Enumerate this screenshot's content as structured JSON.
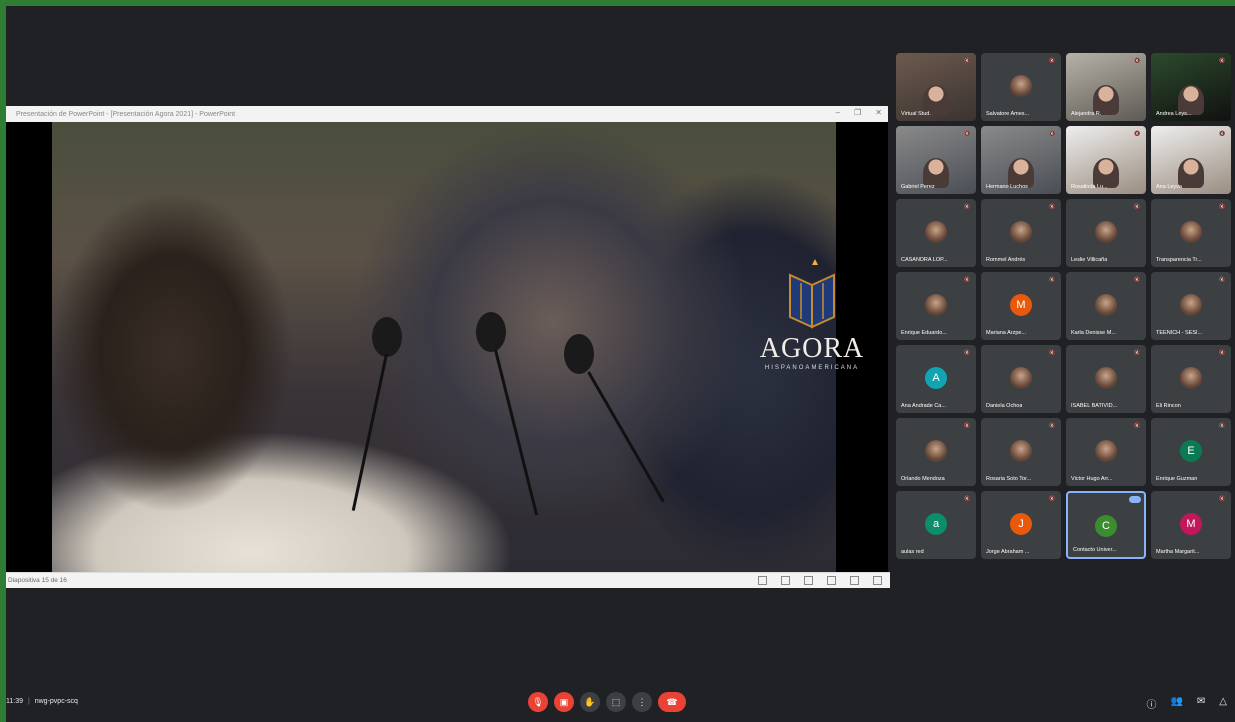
{
  "presentation": {
    "title": "Presentación de PowerPoint - [Presentación Agora 2021] - PowerPoint",
    "status": "Diapositiva 15 de 16",
    "logo_word": "AGORA",
    "logo_sub": "HISPANOAMERICANA"
  },
  "participants": [
    {
      "name": "Virtual Stud.",
      "type": "video",
      "style": "v1"
    },
    {
      "name": "Salvatore Ames...",
      "type": "avatar-photo"
    },
    {
      "name": "Alejandra R.",
      "type": "video",
      "style": "v3"
    },
    {
      "name": "Andrea Leys...",
      "type": "video",
      "style": "v4"
    },
    {
      "name": "Gabriel Perez",
      "type": "video",
      "style": "v2"
    },
    {
      "name": "Hermano Luchos",
      "type": "video",
      "style": "v2"
    },
    {
      "name": "Rosalinda Lu...",
      "type": "video",
      "style": "v5"
    },
    {
      "name": "Ana Leyva",
      "type": "video",
      "style": "v5"
    },
    {
      "name": "CASANDRA LOP...",
      "type": "avatar-photo"
    },
    {
      "name": "Rommel Andrés",
      "type": "avatar-photo"
    },
    {
      "name": "Leslie Villicaña",
      "type": "avatar-photo"
    },
    {
      "name": "Transparencia Tr...",
      "type": "avatar-photo"
    },
    {
      "name": "Enrique Eduardo...",
      "type": "avatar-photo"
    },
    {
      "name": "Mariana Arzpe...",
      "type": "avatar",
      "initial": "M",
      "color": "#e8590c"
    },
    {
      "name": "Karla Denisse M...",
      "type": "avatar-photo"
    },
    {
      "name": "TEENICH - SESI...",
      "type": "avatar-photo"
    },
    {
      "name": "Ana Andrade Ca...",
      "type": "avatar",
      "initial": "A",
      "color": "#12a4b3"
    },
    {
      "name": "Daniela Ochoa",
      "type": "avatar-photo"
    },
    {
      "name": "ISABEL BATIVID...",
      "type": "avatar-photo"
    },
    {
      "name": "Eli Rincon",
      "type": "avatar-photo"
    },
    {
      "name": "Orlando Mendoza",
      "type": "avatar-photo"
    },
    {
      "name": "Rosaria Soto Tor...",
      "type": "avatar-photo"
    },
    {
      "name": "Victor Hugo Arr...",
      "type": "avatar-photo"
    },
    {
      "name": "Enrique Guzman",
      "type": "avatar",
      "initial": "E",
      "color": "#0b7a52"
    },
    {
      "name": "aulas red",
      "type": "avatar",
      "initial": "a",
      "color": "#0b8f6b"
    },
    {
      "name": "Jorge Abraham ...",
      "type": "avatar",
      "initial": "J",
      "color": "#e8590c"
    },
    {
      "name": "Contacto Univer...",
      "type": "avatar",
      "initial": "C",
      "color": "#3c8d2f",
      "active": true
    },
    {
      "name": "Martha Margarit...",
      "type": "avatar",
      "initial": "M",
      "color": "#c2185b"
    }
  ],
  "meeting": {
    "time": "11:39",
    "separator": "|",
    "code": "nwg-pvpc-scq"
  },
  "controls": {
    "mic_icon": "mic-off-icon",
    "cam_icon": "camera-off-icon",
    "hand_icon": "raise-hand-icon",
    "present_icon": "present-screen-icon",
    "more_icon": "more-options-icon",
    "end_icon": "end-call-icon"
  },
  "colors": {
    "frame": "#2e7d32",
    "background": "#202124",
    "tile": "#3c4043",
    "danger": "#ea4335",
    "active_border": "#8ab4f8"
  }
}
